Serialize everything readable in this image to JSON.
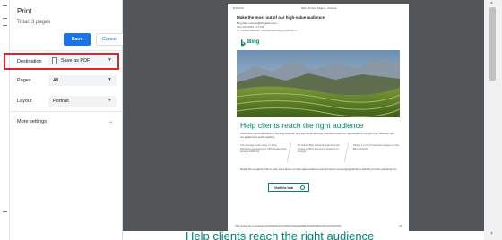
{
  "print_panel": {
    "title": "Print",
    "total": "Total: 3 pages",
    "save_label": "Save",
    "cancel_label": "Cancel",
    "destination": {
      "label": "Destination",
      "value": "Save as PDF"
    },
    "pages": {
      "label": "Pages",
      "value": "All"
    },
    "layout": {
      "label": "Layout",
      "value": "Portrait"
    },
    "more_settings": "More settings",
    "highlight_color": "#e8202a",
    "accent": "#1a73e8"
  },
  "preview_page": {
    "date": "8/1/2019",
    "app_header": "Mail - Printer Shape - Outlook",
    "headline": "Make the most out of our high-value audience",
    "from": "Bing Ads <service@bingads.com>",
    "sent": "Wed 12/6/2018 9:15 AM",
    "to": "To: contoso Webinar <contoso-webinar@outlook.com>",
    "logo_text": "Bing",
    "heading": "Help clients reach the right audience",
    "body": "When your clients advertise on the Bing Network, they tap into an effective channel to reach the right people at the right time. Discover why our audience is worth reaching.",
    "stats": [
      {
        "highlight": "25% greater",
        "text": "The average order value on Bing Shopping Campaigns is 25% greater than Google AdWords"
      },
      {
        "highlight": "58 million",
        "text": "58 million Bing Network searchers are unique to Bing and aren't reached on Google"
      },
      {
        "highlight": "1 in 3 US searches",
        "text": "Nearly 1 in 3 US searches happen on the Bing Network"
      }
    ],
    "footer_text": "Reach bit our agency hub to learn more about our high-value audience and get tips for encouraging clients to add Bing to their marketing mix.",
    "cta": "Visit the hub",
    "url": "https://outlook.live.com/mail/inbox/id/AQMkADAwATYwMDAOLTAwZGEtNWExZC0wMAItMDAKAEYAAAN3AFVHWj",
    "page_num": "1/3",
    "accent": "#008272"
  },
  "bottom_text": "Help clients reach the right audience",
  "icons": {
    "chevron": "chevron-down-icon",
    "pdf": "pdf-file-icon",
    "circle_arrow": "arrow-circle-icon"
  }
}
